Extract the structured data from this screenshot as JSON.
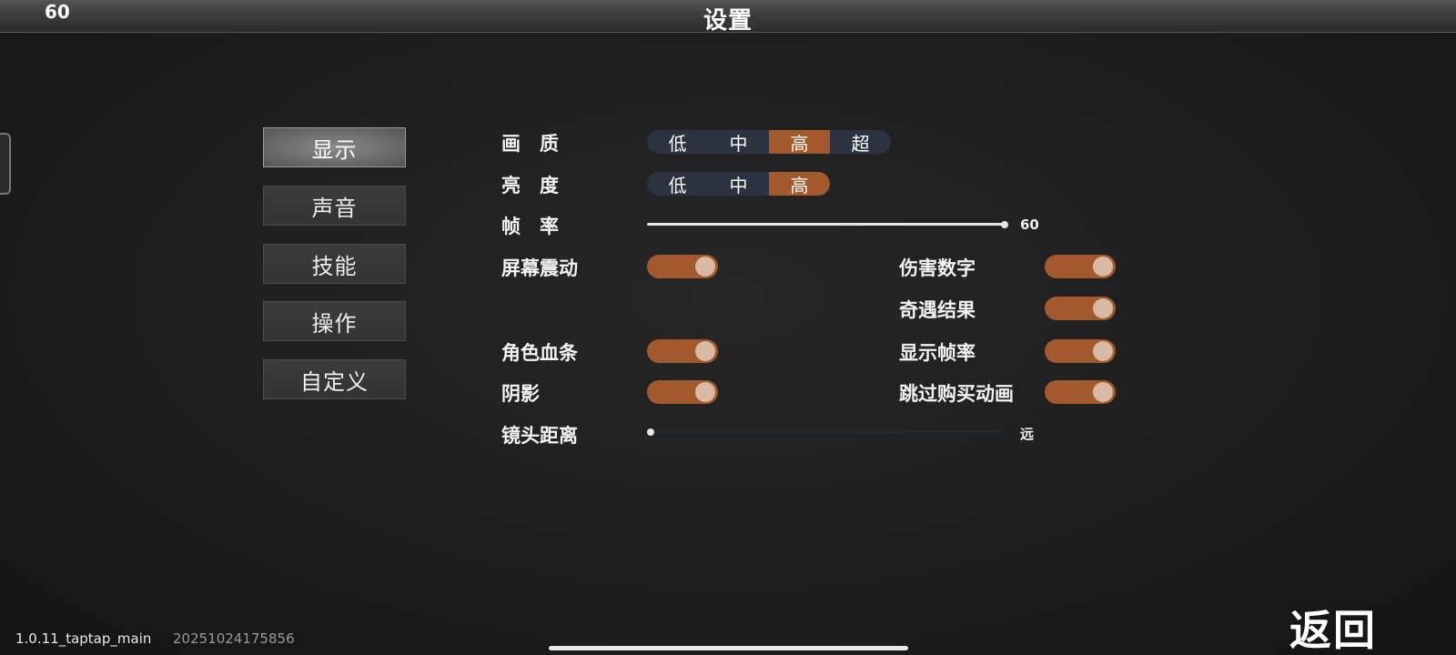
{
  "topbar": {
    "fps": "60",
    "title": "设置"
  },
  "tabs": [
    {
      "label": "显示",
      "active": true
    },
    {
      "label": "声音",
      "active": false
    },
    {
      "label": "技能",
      "active": false
    },
    {
      "label": "操作",
      "active": false
    },
    {
      "label": "自定义",
      "active": false
    }
  ],
  "quality": {
    "label": "画　质",
    "options": [
      "低",
      "中",
      "高",
      "超"
    ],
    "selected": "高"
  },
  "brightness": {
    "label": "亮　度",
    "options": [
      "低",
      "中",
      "高"
    ],
    "selected": "高"
  },
  "framerate": {
    "label": "帧　率",
    "value": "60",
    "level": 1.0
  },
  "toggles_left": [
    {
      "label": "屏幕震动",
      "on": true
    },
    {
      "label": "角色血条",
      "on": true
    },
    {
      "label": "阴影",
      "on": true
    }
  ],
  "toggles_right": [
    {
      "label": "伤害数字",
      "on": true
    },
    {
      "label": "奇遇结果",
      "on": true
    },
    {
      "label": "显示帧率",
      "on": true
    },
    {
      "label": "跳过购买动画",
      "on": true
    }
  ],
  "camera": {
    "label": "镜头距离",
    "value": "远",
    "level": 0.0
  },
  "footer": {
    "version": "1.0.11_taptap_main",
    "build": "20251024175856",
    "back": "返回"
  },
  "colors": {
    "accent": "#a25a2d",
    "segment_bg": "#2b3240",
    "knob": "#d8b9a3"
  }
}
